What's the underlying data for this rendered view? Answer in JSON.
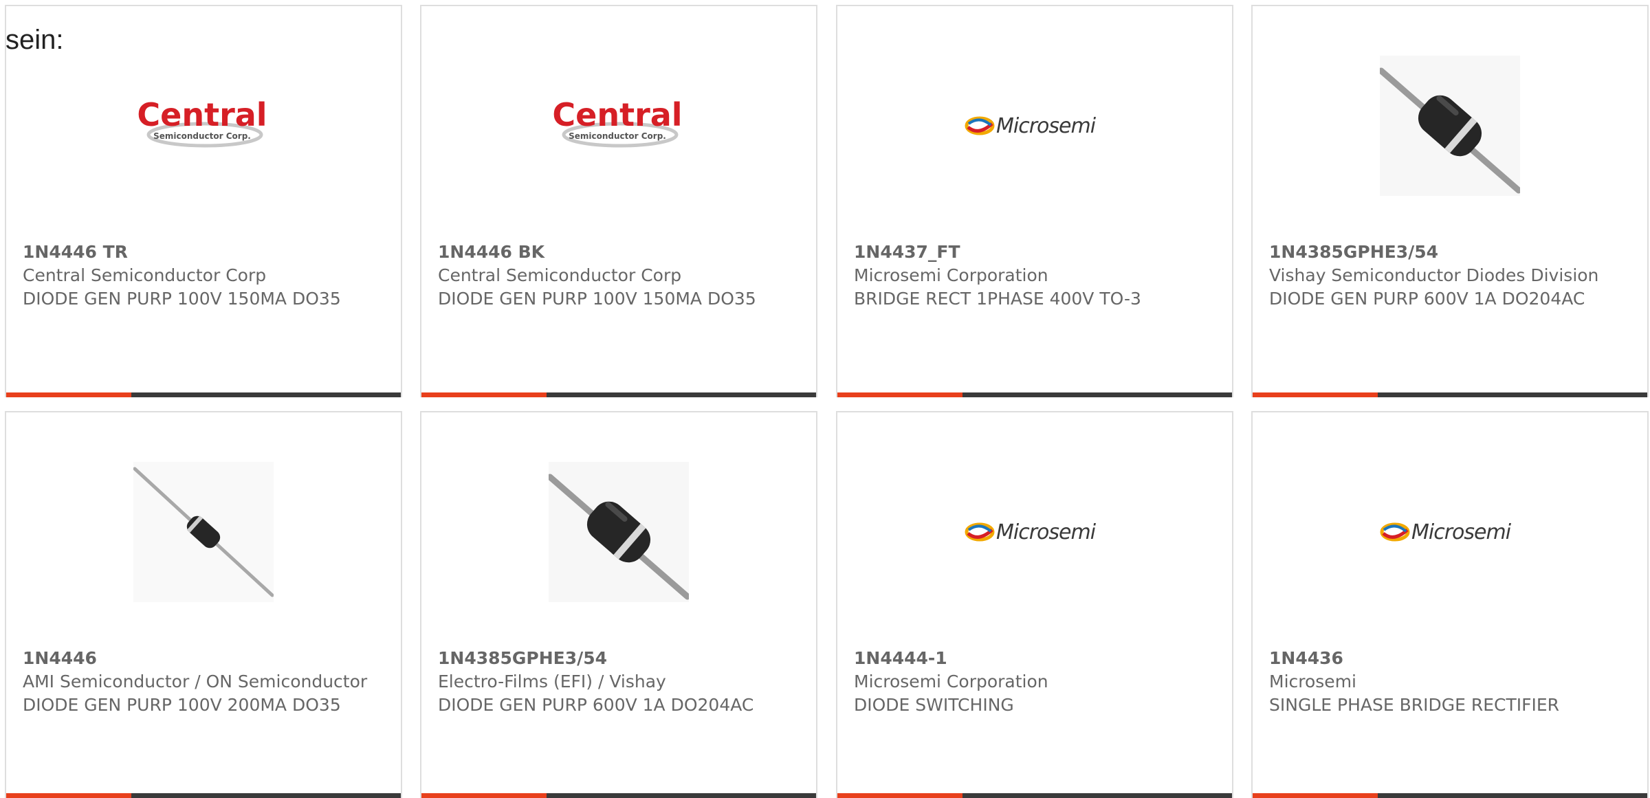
{
  "intro_text": "sein:",
  "accent_color": "#e8401c",
  "bar_color": "#3a3a3a",
  "cards": [
    {
      "part_number": "1N4446 TR",
      "manufacturer": "Central Semiconductor Corp",
      "description": "DIODE GEN PURP 100V 150MA DO35",
      "image": "central-semiconductor-logo",
      "logo_main": "Central",
      "logo_sub": "Semiconductor Corp."
    },
    {
      "part_number": "1N4446 BK",
      "manufacturer": "Central Semiconductor Corp",
      "description": "DIODE GEN PURP 100V 150MA DO35",
      "image": "central-semiconductor-logo",
      "logo_main": "Central",
      "logo_sub": "Semiconductor Corp."
    },
    {
      "part_number": "1N4437_FT",
      "manufacturer": "Microsemi Corporation",
      "description": "BRIDGE RECT 1PHASE 400V TO-3",
      "image": "microsemi-logo",
      "logo_main": "Microsemi"
    },
    {
      "part_number": "1N4385GPHE3/54",
      "manufacturer": "Vishay Semiconductor Diodes Division",
      "description": "DIODE GEN PURP 600V 1A DO204AC",
      "image": "diode-large-photo"
    },
    {
      "part_number": "1N4446",
      "manufacturer": "AMI Semiconductor / ON Semiconductor",
      "description": "DIODE GEN PURP 100V 200MA DO35",
      "image": "diode-small-photo"
    },
    {
      "part_number": "1N4385GPHE3/54",
      "manufacturer": "Electro-Films (EFI) / Vishay",
      "description": "DIODE GEN PURP 600V 1A DO204AC",
      "image": "diode-large-photo"
    },
    {
      "part_number": "1N4444-1",
      "manufacturer": "Microsemi Corporation",
      "description": "DIODE SWITCHING",
      "image": "microsemi-logo",
      "logo_main": "Microsemi"
    },
    {
      "part_number": "1N4436",
      "manufacturer": "Microsemi",
      "description": "SINGLE PHASE BRIDGE RECTIFIER",
      "image": "microsemi-logo",
      "logo_main": "Microsemi"
    }
  ]
}
